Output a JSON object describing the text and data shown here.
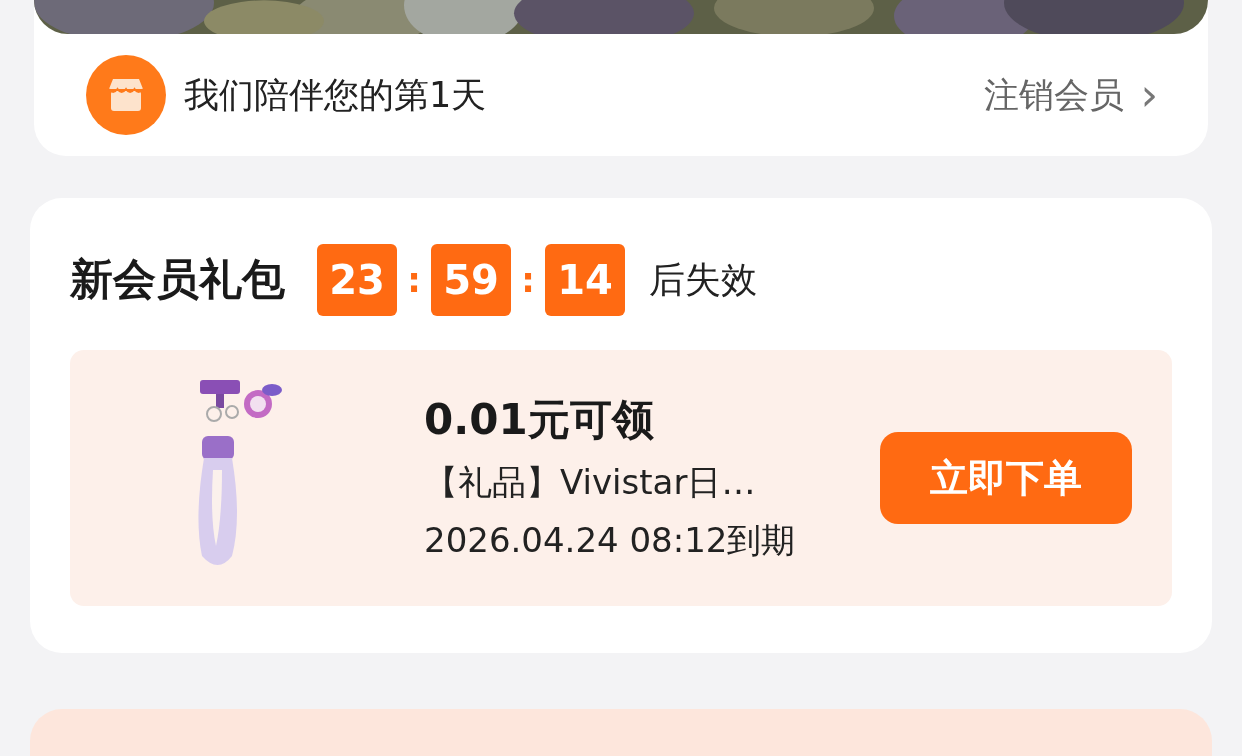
{
  "member_card": {
    "days_text": "我们陪伴您的第1天",
    "cancel_link": "注销会员",
    "cancel_chevron": "›"
  },
  "gift_pack": {
    "title": "新会员礼包",
    "countdown": [
      "23",
      "59",
      "14"
    ],
    "separator": ":",
    "suffix": "后失效",
    "offer": {
      "price": "0.01元可领",
      "name": "【礼品】Vivistar日…",
      "expiry": "2026.04.24 08:12到期",
      "button": "立即下单"
    }
  }
}
